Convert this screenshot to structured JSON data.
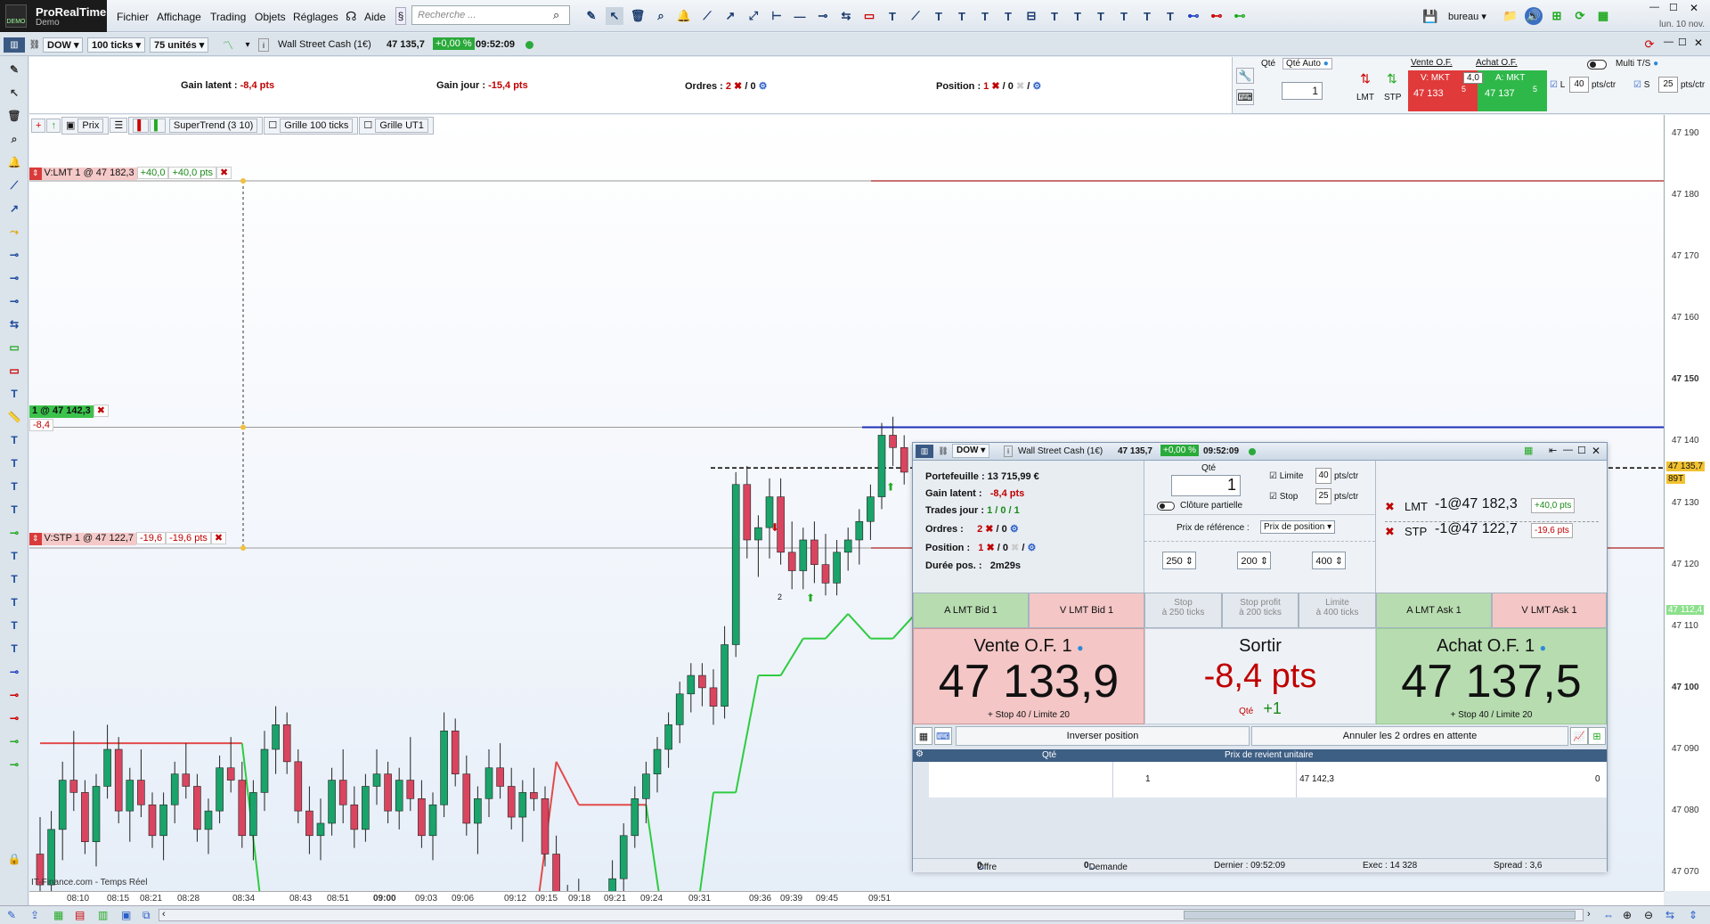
{
  "app": {
    "name": "ProRealTime",
    "edition": "Demo",
    "logo_badge": "DEMO"
  },
  "menu": [
    "Fichier",
    "Affichage",
    "Trading",
    "Objets",
    "Réglages",
    "Aide"
  ],
  "search": {
    "placeholder": "Recherche ..."
  },
  "workspace": "bureau",
  "clock": "lun. 10 nov.",
  "chartbar": {
    "instrument": "DOW",
    "ticks": "100 ticks",
    "units": "75 unités",
    "title": "Wall Street Cash (1€)",
    "last": "47 135,7",
    "change": "+0,00 %",
    "time": "09:52:09"
  },
  "infobar": {
    "gain_latent_label": "Gain latent :",
    "gain_latent": "-8,4 pts",
    "gain_jour_label": "Gain jour :",
    "gain_jour": "-15,4 pts",
    "ordres_label": "Ordres :",
    "ordres_n": "2",
    "ordres_sep": "/ 0",
    "position_label": "Position :",
    "position_n": "1",
    "position_sep": "/ 0",
    "position_sep2": "/"
  },
  "orderpanel": {
    "qte_label": "Qté",
    "qte_auto": "Qté Auto",
    "qte": "1",
    "lmt": "LMT",
    "stp": "STP",
    "vente_label": "Vente O.F.",
    "achat_label": "Achat O.F.",
    "v_mkt": "V: MKT",
    "a_mkt": "A: MKT",
    "spread": "4,0",
    "bid_big": "47 133",
    "bid_small": "5",
    "ask_big": "47 137",
    "ask_small": "5",
    "multi": "Multi T/S",
    "l_label": "L",
    "l_val": "40",
    "s_label": "S",
    "s_val": "25",
    "unit": "pts/ctr"
  },
  "indicators": [
    "Prix",
    "SuperTrend (3 10)",
    "Grille 100 ticks",
    "Grille UT1"
  ],
  "chart_labels": {
    "vlmt": "V:LMT 1 @ 47 182,3",
    "vlmt_p1": "+40,0",
    "vlmt_p2": "+40,0",
    "vlmt_unit": "pts",
    "pos": "1 @ 47 142,3",
    "pos_pl": "-8,4",
    "vstp": "V:STP 1 @ 47 122,7",
    "vstp_p1": "-19,6",
    "vstp_p2": "-19,6",
    "vstp_unit": "pts",
    "source": "IT-Finance.com - Temps Réel",
    "marker2": "2"
  },
  "price_axis": {
    "ticks": [
      {
        "v": 47190,
        "t": "47 190"
      },
      {
        "v": 47180,
        "t": "47 180"
      },
      {
        "v": 47170,
        "t": "47 170"
      },
      {
        "v": 47160,
        "t": "47 160"
      },
      {
        "v": 47150,
        "t": "47 150"
      },
      {
        "v": 47140,
        "t": "47 140"
      },
      {
        "v": 47130,
        "t": "47 130"
      },
      {
        "v": 47120,
        "t": "47 120"
      },
      {
        "v": 47110,
        "t": "47 110"
      },
      {
        "v": 47100,
        "t": "47 100"
      },
      {
        "v": 47090,
        "t": "47 090"
      },
      {
        "v": 47080,
        "t": "47 080"
      },
      {
        "v": 47070,
        "t": "47 070"
      }
    ],
    "last": "47 135,7",
    "last_sub": "89T",
    "st": "47 112,4"
  },
  "time_axis": [
    "08:10",
    "08:15",
    "08:21",
    "08:28",
    "08:34",
    "08:43",
    "08:51",
    "09:00",
    "09:03",
    "09:06",
    "09:12",
    "09:15",
    "09:18",
    "09:21",
    "09:24",
    "09:31",
    "09:36",
    "09:39",
    "09:45",
    "09:51"
  ],
  "ticket": {
    "instrument": "DOW",
    "title": "Wall Street Cash (1€)",
    "last": "47 135,7",
    "change": "+0,00 %",
    "time": "09:52:09",
    "portefeuille": "Portefeuille : 13 715,99 €",
    "gain_latent_label": "Gain latent :",
    "gain_latent": "-8,4 pts",
    "trades_label": "Trades jour :",
    "trades": "1 / 0 / 1",
    "ordres_label": "Ordres :",
    "ordres": "2",
    "ordres_sep": "/ 0",
    "position_label": "Position :",
    "position": "1",
    "position_sep": "/ 0",
    "position_sep2": "/",
    "duree_label": "Durée pos. :",
    "duree": "2m29s",
    "qte_label": "Qté",
    "qte": "1",
    "cloture": "Clôture partielle",
    "limite": "Limite",
    "limite_val": "40",
    "stop": "Stop",
    "stop_val": "25",
    "unit": "pts/ctr",
    "prix_ref_label": "Prix de référence :",
    "prix_ref": "Prix de position",
    "spin1": "250",
    "spin2": "200",
    "spin3": "400",
    "lmt_label": "LMT",
    "lmt": "-1@47 182,3",
    "lmt_pl": "+40,0 pts",
    "stp_label": "STP",
    "stp": "-1@47 122,7",
    "stp_pl": "-19,6 pts",
    "a_lmt_bid": "A LMT Bid 1",
    "v_lmt_bid": "V LMT Bid 1",
    "stop250": "Stop",
    "stop250_sub": "à 250 ticks",
    "stopprofit": "Stop profit",
    "stopprofit_sub": "à 200 ticks",
    "limite400": "Limite",
    "limite400_sub": "à 400 ticks",
    "a_lmt_ask": "A LMT Ask 1",
    "v_lmt_ask": "V LMT Ask 1",
    "vente_label": "Vente O.F. 1",
    "vente": "47 133,9",
    "vente_sub": "+ Stop 40 / Limite 20",
    "sortir": "Sortir",
    "sortir_val": "-8,4 pts",
    "sortir_qte_label": "Qté",
    "sortir_qte": "+1",
    "achat_label": "Achat O.F. 1",
    "achat": "47 137,5",
    "achat_sub": "+ Stop 40 / Limite 20",
    "inverser": "Inverser position",
    "annuler": "Annuler les 2 ordres en attente",
    "col_qte": "Qté",
    "col_prix": "Prix de revient unitaire",
    "row_qte": "1",
    "row_prix": "47 142,3",
    "row_pl": "0",
    "offre": "Offre",
    "offre_v": "0",
    "demande_v": "0",
    "demande": "Demande",
    "dernier": "Dernier : 09:52:09",
    "exec": "Exec : 14 328",
    "spread": "Spread : 3,6"
  },
  "colors": {
    "up": "#1aa36a",
    "down": "#d9455f",
    "supertrend_up": "#2ecc40",
    "supertrend_down": "#e24b4b",
    "sell_bg": "#f4c6c6",
    "buy_bg": "#b7dcb0",
    "pos_line": "#1d2fb5",
    "order_line": "#b84444"
  },
  "chart_data": {
    "type": "candlestick",
    "ylim": [
      47067,
      47193
    ],
    "levels": {
      "sell_limit": 47182.3,
      "position": 47142.3,
      "sell_stop": 47122.7,
      "last": 47135.7
    },
    "candles": [
      [
        47073,
        47079,
        47066,
        47068
      ],
      [
        47068,
        47080,
        47067,
        47077
      ],
      [
        47077,
        47088,
        47072,
        47085
      ],
      [
        47085,
        47093,
        47080,
        47083
      ],
      [
        47083,
        47085,
        47073,
        47075
      ],
      [
        47075,
        47086,
        47071,
        47084
      ],
      [
        47084,
        47094,
        47082,
        47090
      ],
      [
        47090,
        47092,
        47078,
        47080
      ],
      [
        47080,
        47087,
        47075,
        47085
      ],
      [
        47085,
        47090,
        47079,
        47081
      ],
      [
        47081,
        47083,
        47074,
        47076
      ],
      [
        47076,
        47083,
        47072,
        47081
      ],
      [
        47081,
        47088,
        47078,
        47086
      ],
      [
        47086,
        47091,
        47082,
        47084
      ],
      [
        47084,
        47086,
        47075,
        47077
      ],
      [
        47077,
        47082,
        47073,
        47080
      ],
      [
        47080,
        47089,
        47078,
        47087
      ],
      [
        47087,
        47092,
        47083,
        47085
      ],
      [
        47085,
        47088,
        47074,
        47076
      ],
      [
        47076,
        47085,
        47072,
        47083
      ],
      [
        47083,
        47093,
        47080,
        47090
      ],
      [
        47090,
        47097,
        47086,
        47094
      ],
      [
        47094,
        47096,
        47086,
        47088
      ],
      [
        47088,
        47090,
        47078,
        47080
      ],
      [
        47080,
        47084,
        47073,
        47076
      ],
      [
        47076,
        47082,
        47072,
        47078
      ],
      [
        47078,
        47087,
        47076,
        47085
      ],
      [
        47085,
        47090,
        47078,
        47081
      ],
      [
        47081,
        47084,
        47074,
        47077
      ],
      [
        47077,
        47086,
        47075,
        47084
      ],
      [
        47084,
        47090,
        47081,
        47086
      ],
      [
        47086,
        47088,
        47078,
        47080
      ],
      [
        47080,
        47087,
        47077,
        47085
      ],
      [
        47085,
        47092,
        47080,
        47082
      ],
      [
        47082,
        47085,
        47074,
        47076
      ],
      [
        47076,
        47083,
        47072,
        47081
      ],
      [
        47081,
        47096,
        47079,
        47093
      ],
      [
        47093,
        47095,
        47084,
        47086
      ],
      [
        47086,
        47089,
        47076,
        47078
      ],
      [
        47078,
        47084,
        47073,
        47082
      ],
      [
        47082,
        47090,
        47079,
        47087
      ],
      [
        47087,
        47091,
        47082,
        47084
      ],
      [
        47084,
        47087,
        47077,
        47079
      ],
      [
        47079,
        47085,
        47075,
        47083
      ],
      [
        47083,
        47087,
        47080,
        47082
      ],
      [
        47082,
        47084,
        47071,
        47073
      ],
      [
        47073,
        47076,
        47060,
        47062
      ],
      [
        47062,
        47068,
        47055,
        47064
      ],
      [
        47064,
        47069,
        47058,
        47061
      ],
      [
        47061,
        47066,
        47054,
        47059
      ],
      [
        47059,
        47067,
        47056,
        47065
      ],
      [
        47065,
        47072,
        47062,
        47069
      ],
      [
        47069,
        47078,
        47066,
        47076
      ],
      [
        47076,
        47084,
        47074,
        47082
      ],
      [
        47082,
        47088,
        47078,
        47086
      ],
      [
        47086,
        47092,
        47083,
        47090
      ],
      [
        47090,
        47096,
        47087,
        47094
      ],
      [
        47094,
        47101,
        47091,
        47099
      ],
      [
        47099,
        47104,
        47096,
        47102
      ],
      [
        47102,
        47104,
        47097,
        47100
      ],
      [
        47100,
        47103,
        47094,
        47097
      ],
      [
        47097,
        47110,
        47095,
        47107
      ],
      [
        47107,
        47135,
        47105,
        47133
      ],
      [
        47133,
        47136,
        47121,
        47124
      ],
      [
        47124,
        47128,
        47118,
        47126
      ],
      [
        47126,
        47134,
        47121,
        47131
      ],
      [
        47131,
        47134,
        47120,
        47122
      ],
      [
        47122,
        47127,
        47116,
        47119
      ],
      [
        47119,
        47126,
        47116,
        47124
      ],
      [
        47124,
        47127,
        47117,
        47120
      ],
      [
        47120,
        47125,
        47115,
        47117
      ],
      [
        47117,
        47124,
        47115,
        47122
      ],
      [
        47122,
        47126,
        47119,
        47124
      ],
      [
        47124,
        47129,
        47120,
        47127
      ],
      [
        47127,
        47133,
        47124,
        47131
      ],
      [
        47131,
        47143,
        47129,
        47141
      ],
      [
        47141,
        47144,
        47136,
        47139
      ],
      [
        47139,
        47141,
        47133,
        47135
      ]
    ],
    "supertrend": [
      [
        0,
        47091
      ],
      [
        18,
        47091
      ],
      [
        20,
        47060
      ],
      [
        44,
        47060
      ],
      [
        46,
        47088
      ],
      [
        48,
        47081
      ],
      [
        50,
        47081
      ],
      [
        54,
        47081
      ],
      [
        56,
        47056
      ],
      [
        58,
        47056
      ],
      [
        60,
        47083
      ],
      [
        62,
        47083
      ],
      [
        64,
        47102
      ],
      [
        66,
        47102
      ],
      [
        68,
        47108
      ],
      [
        70,
        47108
      ],
      [
        72,
        47112
      ],
      [
        74,
        47108
      ],
      [
        76,
        47108
      ],
      [
        78,
        47112
      ],
      [
        80,
        47112
      ]
    ]
  }
}
